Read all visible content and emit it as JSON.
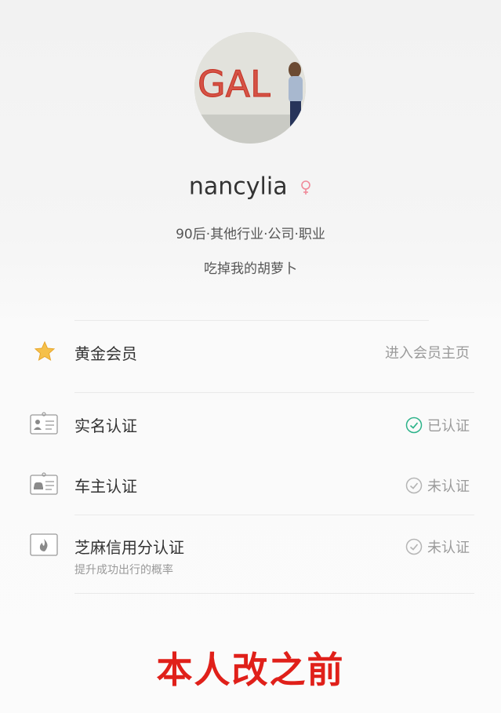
{
  "profile": {
    "avatar_text": "GAL",
    "username": "nancylia",
    "gender_icon": "female-icon",
    "tagline": "90后·其他行业·公司·职业",
    "signature": "吃掉我的胡萝卜"
  },
  "rows": [
    {
      "label": "黄金会员",
      "right": "进入会员主页",
      "icon": "star-icon"
    },
    {
      "label": "实名认证",
      "right": "已认证",
      "icon": "id-card-icon",
      "status": "verified"
    },
    {
      "label": "车主认证",
      "right": "未认证",
      "icon": "car-owner-card-icon",
      "status": "unverified"
    },
    {
      "label": "芝麻信用分认证",
      "sub": "提升成功出行的概率",
      "right": "未认证",
      "icon": "sesame-credit-icon",
      "status": "unverified"
    }
  ],
  "colors": {
    "verified": "#2db38a",
    "unverified": "#b5b5b5",
    "star": "#f5b52a",
    "caption": "#e0201a",
    "gender": "#f08a9a"
  },
  "caption": "本人改之前"
}
